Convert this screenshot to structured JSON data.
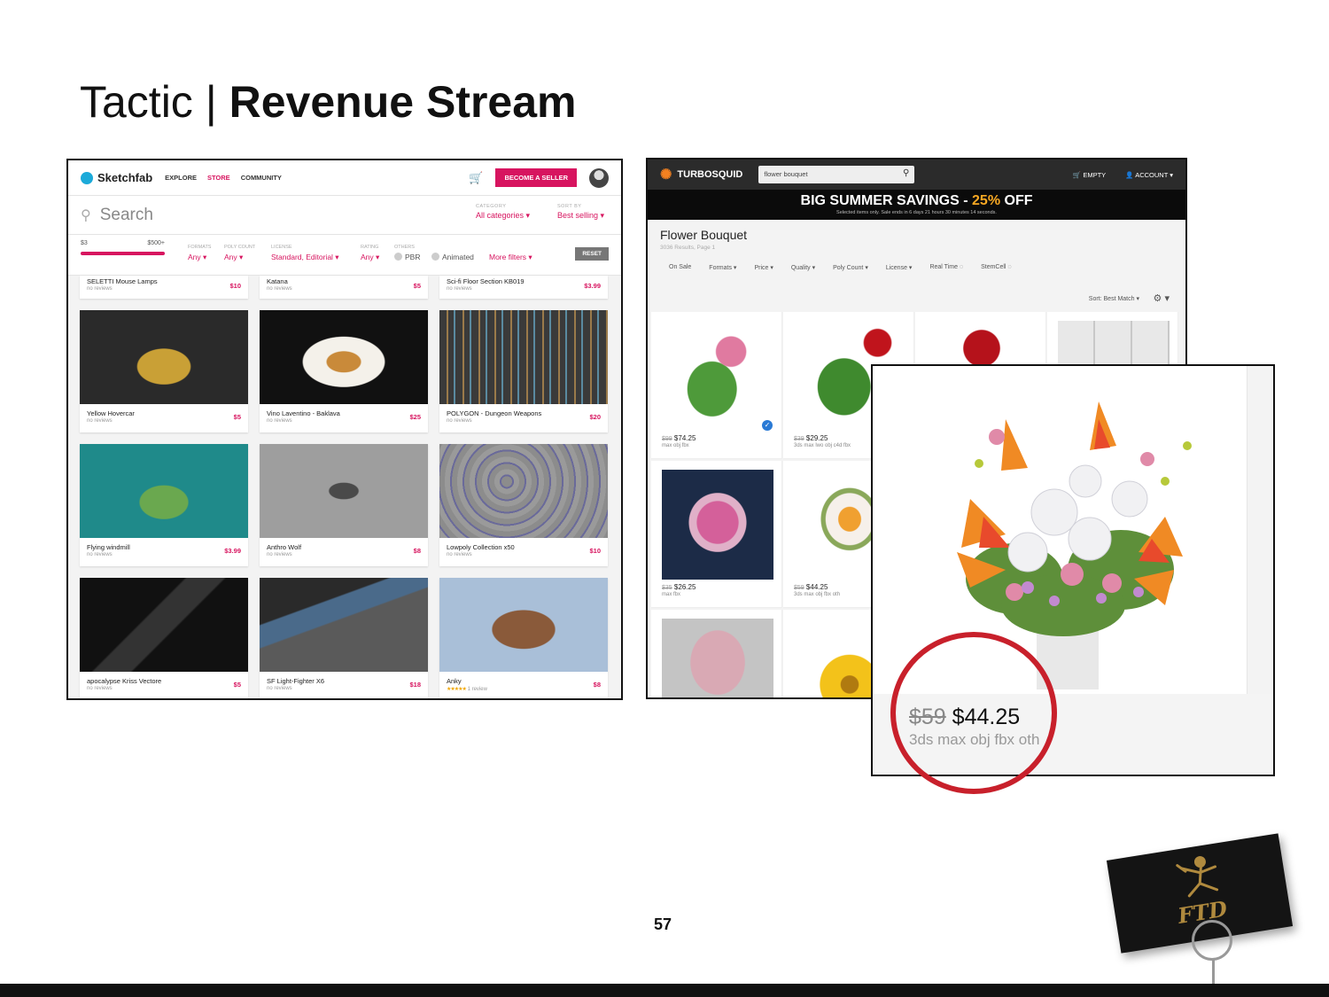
{
  "slide": {
    "title_regular": "Tactic",
    "title_sep": "|",
    "title_bold": "Revenue Stream",
    "page_number": "57"
  },
  "sketchfab": {
    "brand": "Sketchfab",
    "nav": [
      "EXPLORE",
      "STORE",
      "COMMUNITY"
    ],
    "seller_button": "BECOME A SELLER",
    "search_placeholder": "Search",
    "category_label": "CATEGORY",
    "category_value": "All categories",
    "sort_label": "SORT BY",
    "sort_value": "Best selling",
    "price_min": "$3",
    "price_max": "$500+",
    "filters": [
      {
        "label": "FORMATS",
        "value": "Any"
      },
      {
        "label": "POLY COUNT",
        "value": "Any"
      },
      {
        "label": "LICENSE",
        "value": "Standard, Editorial"
      },
      {
        "label": "RATING",
        "value": "Any"
      },
      {
        "label": "OTHERS",
        "value": "PBR"
      }
    ],
    "animated_label": "Animated",
    "more_filters": "More filters",
    "reset": "RESET",
    "top_row": [
      {
        "name": "SELETTI Mouse Lamps",
        "reviews": "no reviews",
        "price": "$10"
      },
      {
        "name": "Katana",
        "reviews": "no reviews",
        "price": "$5"
      },
      {
        "name": "Sci-fi Floor Section KB019",
        "reviews": "no reviews",
        "price": "$3.99"
      }
    ],
    "cards": [
      {
        "name": "Yellow Hovercar",
        "reviews": "no reviews",
        "price": "$5"
      },
      {
        "name": "Vino Laventino - Baklava",
        "reviews": "no reviews",
        "price": "$25"
      },
      {
        "name": "POLYGON - Dungeon Weapons",
        "reviews": "no reviews",
        "price": "$20"
      },
      {
        "name": "Flying windmill",
        "reviews": "no reviews",
        "price": "$3.99"
      },
      {
        "name": "Anthro Wolf",
        "reviews": "no reviews",
        "price": "$8"
      },
      {
        "name": "Lowpoly Collection x50",
        "reviews": "no reviews",
        "price": "$10"
      },
      {
        "name": "apocalypse Kriss Vectore",
        "reviews": "no reviews",
        "price": "$5"
      },
      {
        "name": "SF Light-Fighter X6",
        "reviews": "no reviews",
        "price": "$18"
      },
      {
        "name": "Anky",
        "reviews": "1 review",
        "price": "$8"
      }
    ]
  },
  "turbosquid": {
    "brand": "TURBOSQUID",
    "search_value": "flower bouquet",
    "cart": "EMPTY",
    "account": "ACCOUNT",
    "banner_main": "BIG SUMMER SAVINGS - ",
    "banner_accent": "25%",
    "banner_end": " OFF",
    "banner_sub": "Selected items only. Sale ends in 6 days 21 hours 30 minutes 14 seconds.",
    "results_title": "Flower Bouquet",
    "results_sub": "3036 Results, Page 1",
    "filters": [
      "On Sale",
      "Formats",
      "Price",
      "Quality",
      "Poly Count",
      "License",
      "Real Time",
      "StemCell"
    ],
    "sort": "Sort: Best Match",
    "items": [
      {
        "old": "$99",
        "price": "$74.25",
        "fmt": "max obj fbx"
      },
      {
        "old": "$39",
        "price": "$29.25",
        "fmt": "3ds max lwo obj c4d fbx"
      },
      {
        "old": "$35",
        "price": "$26.25",
        "fmt": "max fbx"
      },
      {
        "old": "$59",
        "price": "$44.25",
        "fmt": "3ds max obj fbx oth"
      }
    ],
    "zoom_old": "$59",
    "zoom_price": "$44.25",
    "zoom_fmt": "3ds max obj fbx oth"
  },
  "ftd": {
    "logo_text": "FTD"
  },
  "colors": {
    "sketchfab_accent": "#d7145f",
    "turbosquid_bar": "#2b2b2b",
    "sale_accent": "#f7a823",
    "highlight_circle": "#c8202b"
  }
}
